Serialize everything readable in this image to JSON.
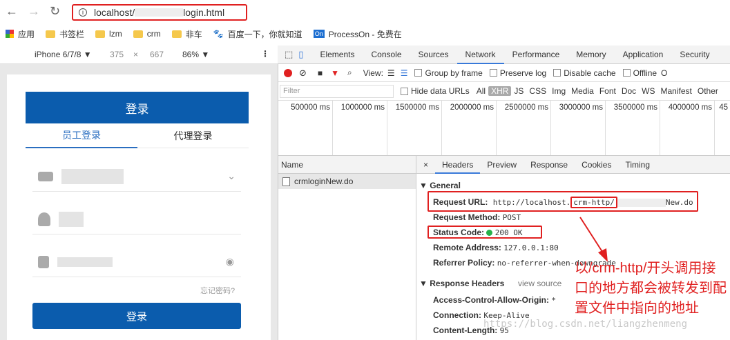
{
  "browser": {
    "url_prefix": "localhost/",
    "url_suffix": "login.html",
    "bookmarks": [
      {
        "label": "应用",
        "icon": "apps-grid-icon"
      },
      {
        "label": "书签栏",
        "icon": "folder-icon"
      },
      {
        "label": "lzm",
        "icon": "folder-icon"
      },
      {
        "label": "crm",
        "icon": "folder-icon"
      },
      {
        "label": "非车",
        "icon": "folder-icon"
      },
      {
        "label": "百度一下，你就知道",
        "icon": "baidu-paw-icon"
      },
      {
        "label": "ProcessOn - 免费在",
        "icon": "processon-icon"
      }
    ]
  },
  "device_toolbar": {
    "device": "iPhone 6/7/8 ▼",
    "width": "375",
    "times": "×",
    "height": "667",
    "zoom": "86% ▼",
    "more": "⋮"
  },
  "login_page": {
    "header": "登录",
    "tab_employee": "员工登录",
    "tab_agent": "代理登录",
    "forgot": "忘记密码?",
    "submit": "登录"
  },
  "devtools": {
    "tabs": [
      "Elements",
      "Console",
      "Sources",
      "Network",
      "Performance",
      "Memory",
      "Application",
      "Security"
    ],
    "selected_tab": "Network",
    "controls": {
      "view": "View:",
      "group_by_frame": "Group by frame",
      "preserve_log": "Preserve log",
      "disable_cache": "Disable cache",
      "offline": "Offline",
      "online_trunc": "O"
    },
    "filter": {
      "placeholder": "Filter",
      "hide_data_urls": "Hide data URLs",
      "types": [
        "All",
        "XHR",
        "JS",
        "CSS",
        "Img",
        "Media",
        "Font",
        "Doc",
        "WS",
        "Manifest",
        "Other"
      ],
      "selected_type": "XHR"
    },
    "timeline_ticks": [
      "500000 ms",
      "1000000 ms",
      "1500000 ms",
      "2000000 ms",
      "2500000 ms",
      "3000000 ms",
      "3500000 ms",
      "4000000 ms",
      "45"
    ],
    "name_header": "Name",
    "request_name": "crmloginNew.do",
    "detail_tabs": [
      "×",
      "Headers",
      "Preview",
      "Response",
      "Cookies",
      "Timing"
    ],
    "selected_detail_tab": "Headers",
    "general": {
      "title": "▼ General",
      "request_url_label": "Request URL:",
      "request_url_a": "http://localhost.",
      "request_url_b": "crm-http/",
      "request_url_c": "New.do",
      "method_label": "Request Method:",
      "method": "POST",
      "status_label": "Status Code:",
      "status": "200 OK",
      "status_color": "#27b14a",
      "remote_label": "Remote Address:",
      "remote": "127.0.0.1:80",
      "referrer_label": "Referrer Policy:",
      "referrer": "no-referrer-when-downgrade"
    },
    "response_headers": {
      "title": "▼ Response Headers",
      "view_source": "view source",
      "acao_label": "Access-Control-Allow-Origin:",
      "acao": "*",
      "conn_label": "Connection:",
      "conn": "Keep-Alive",
      "len_label": "Content-Length:",
      "len": "95"
    }
  },
  "annotation": "以/crm-http/开头调用接口的地方都会被转发到配置文件中指向的地址",
  "watermark": "https://blog.csdn.net/liangzhenmeng"
}
